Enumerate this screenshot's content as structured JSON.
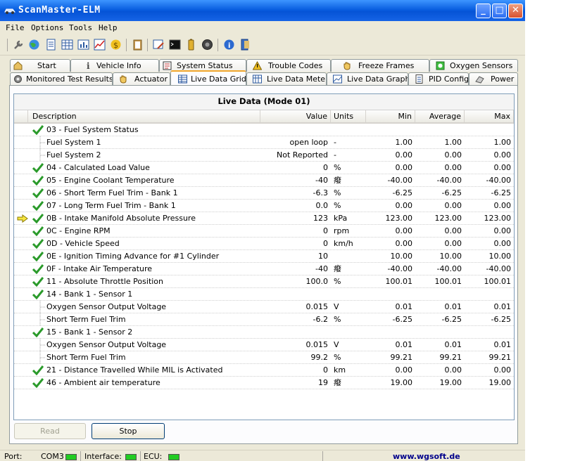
{
  "window": {
    "title": "ScanMaster-ELM",
    "minimize_label": "_",
    "maximize_label": "□",
    "close_label": "✕"
  },
  "menu": [
    "File",
    "Options",
    "Tools",
    "Help"
  ],
  "toolbar": {
    "icons": [
      "wrench-icon",
      "globe-icon",
      "document-icon",
      "grid-icon",
      "chart-icon",
      "graph-icon",
      "dollar-icon",
      "clipboard-icon",
      "edit-icon",
      "terminal-icon",
      "battery-icon",
      "dial-icon",
      "info-icon",
      "exit-door-icon"
    ]
  },
  "tabs_row1": [
    {
      "label": "Start",
      "icon": "house-icon"
    },
    {
      "label": "Vehicle Info",
      "icon": "info-icon"
    },
    {
      "label": "System Status",
      "icon": "status-icon"
    },
    {
      "label": "Trouble Codes",
      "icon": "warning-icon"
    },
    {
      "label": "Freeze Frames",
      "icon": "hand-icon"
    },
    {
      "label": "Oxygen Sensors",
      "icon": "oxygen-icon"
    }
  ],
  "tabs_row2": [
    {
      "label": "Monitored Test Results",
      "icon": "gear-icon"
    },
    {
      "label": "Actuator",
      "icon": "hand-icon"
    },
    {
      "label": "Live Data Grid",
      "icon": "table-icon",
      "active": true
    },
    {
      "label": "Live Data Meter",
      "icon": "meter-icon"
    },
    {
      "label": "Live Data Graph",
      "icon": "graph-icon"
    },
    {
      "label": "PID Config",
      "icon": "config-icon"
    },
    {
      "label": "Power",
      "icon": "power-icon"
    }
  ],
  "grid": {
    "title": "Live Data (Mode 01)",
    "columns": {
      "description": "Description",
      "value": "Value",
      "units": "Units",
      "min": "Min",
      "average": "Average",
      "max": "Max"
    },
    "rows": [
      {
        "marker": "check",
        "child": false,
        "description": "03 - Fuel System Status",
        "value": "",
        "units": "",
        "min": "",
        "average": "",
        "max": ""
      },
      {
        "marker": "none",
        "child": true,
        "description": "Fuel System 1",
        "value": "open loop",
        "units": "-",
        "min": "1.00",
        "average": "1.00",
        "max": "1.00"
      },
      {
        "marker": "none",
        "child": true,
        "description": "Fuel System 2",
        "value": "Not Reported",
        "units": "-",
        "min": "0.00",
        "average": "0.00",
        "max": "0.00"
      },
      {
        "marker": "check",
        "child": false,
        "description": "04 - Calculated Load Value",
        "value": "0",
        "units": "%",
        "min": "0.00",
        "average": "0.00",
        "max": "0.00"
      },
      {
        "marker": "check",
        "child": false,
        "description": "05 - Engine Coolant Temperature",
        "value": "-40",
        "units": "癈",
        "min": "-40.00",
        "average": "-40.00",
        "max": "-40.00"
      },
      {
        "marker": "check",
        "child": false,
        "description": "06 - Short Term Fuel Trim - Bank 1",
        "value": "-6.3",
        "units": "%",
        "min": "-6.25",
        "average": "-6.25",
        "max": "-6.25"
      },
      {
        "marker": "check",
        "child": false,
        "description": "07 - Long Term Fuel Trim - Bank 1",
        "value": "0.0",
        "units": "%",
        "min": "0.00",
        "average": "0.00",
        "max": "0.00"
      },
      {
        "marker": "arrow-check",
        "child": false,
        "description": "0B - Intake Manifold Absolute Pressure",
        "value": "123",
        "units": "kPa",
        "min": "123.00",
        "average": "123.00",
        "max": "123.00"
      },
      {
        "marker": "check",
        "child": false,
        "description": "0C - Engine RPM",
        "value": "0",
        "units": "rpm",
        "min": "0.00",
        "average": "0.00",
        "max": "0.00"
      },
      {
        "marker": "check",
        "child": false,
        "description": "0D - Vehicle Speed",
        "value": "0",
        "units": "km/h",
        "min": "0.00",
        "average": "0.00",
        "max": "0.00"
      },
      {
        "marker": "check",
        "child": false,
        "description": "0E - Ignition Timing Advance for #1 Cylinder",
        "value": "10",
        "units": "",
        "min": "10.00",
        "average": "10.00",
        "max": "10.00"
      },
      {
        "marker": "check",
        "child": false,
        "description": "0F - Intake Air Temperature",
        "value": "-40",
        "units": "癈",
        "min": "-40.00",
        "average": "-40.00",
        "max": "-40.00"
      },
      {
        "marker": "check",
        "child": false,
        "description": "11 - Absolute Throttle Position",
        "value": "100.0",
        "units": "%",
        "min": "100.01",
        "average": "100.01",
        "max": "100.01"
      },
      {
        "marker": "check",
        "child": false,
        "description": "14 - Bank 1 - Sensor 1",
        "value": "",
        "units": "",
        "min": "",
        "average": "",
        "max": ""
      },
      {
        "marker": "none",
        "child": true,
        "description": "Oxygen Sensor Output Voltage",
        "value": "0.015",
        "units": "V",
        "min": "0.01",
        "average": "0.01",
        "max": "0.01"
      },
      {
        "marker": "none",
        "child": true,
        "description": "Short Term Fuel Trim",
        "value": "-6.2",
        "units": "%",
        "min": "-6.25",
        "average": "-6.25",
        "max": "-6.25"
      },
      {
        "marker": "check",
        "child": false,
        "description": "15 - Bank 1 - Sensor 2",
        "value": "",
        "units": "",
        "min": "",
        "average": "",
        "max": ""
      },
      {
        "marker": "none",
        "child": true,
        "description": "Oxygen Sensor Output Voltage",
        "value": "0.015",
        "units": "V",
        "min": "0.01",
        "average": "0.01",
        "max": "0.01"
      },
      {
        "marker": "none",
        "child": true,
        "description": "Short Term Fuel Trim",
        "value": "99.2",
        "units": "%",
        "min": "99.21",
        "average": "99.21",
        "max": "99.21"
      },
      {
        "marker": "check",
        "child": false,
        "description": "21 - Distance Travelled While MIL is Activated",
        "value": "0",
        "units": "km",
        "min": "0.00",
        "average": "0.00",
        "max": "0.00"
      },
      {
        "marker": "check",
        "child": false,
        "description": "46 - Ambient air temperature",
        "value": "19",
        "units": "癈",
        "min": "19.00",
        "average": "19.00",
        "max": "19.00"
      }
    ]
  },
  "buttons": {
    "read_label": "Read",
    "stop_label": "Stop"
  },
  "status": {
    "port_label": "Port:",
    "port_value": "COM3",
    "interface_label": "Interface:",
    "ecu_label": "ECU:",
    "website": "www.wgsoft.de",
    "led_color": "#22cc22"
  }
}
